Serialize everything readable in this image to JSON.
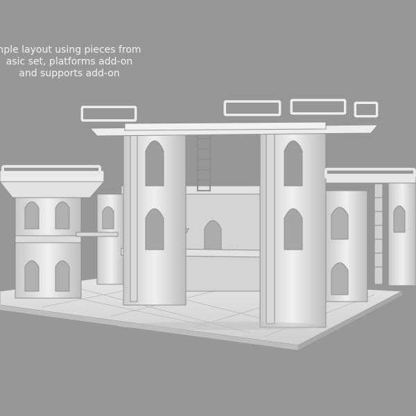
{
  "caption": {
    "line1": "nple layout using pieces from",
    "line2": "asic set, platforms add-on",
    "line3": "and supports add-on"
  },
  "colors": {
    "background": "#979797",
    "model_light": "#eeeeee",
    "model_mid": "#d6d6d6",
    "model_dark": "#a9a9a9",
    "shadow": "#7d7d7d"
  }
}
